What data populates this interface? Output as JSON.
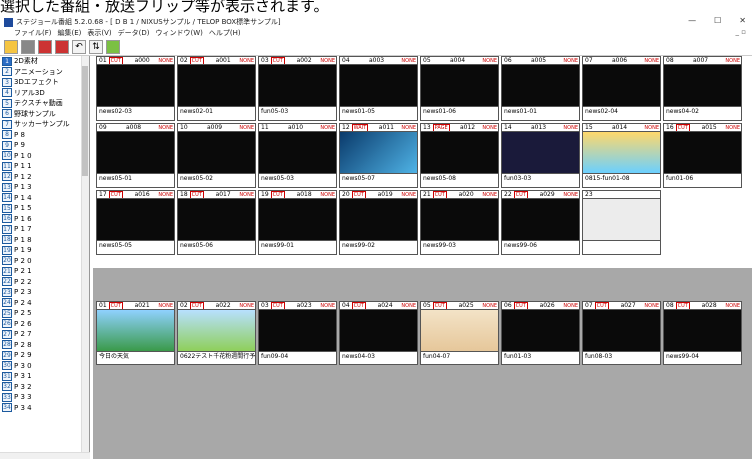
{
  "caption": "選択した番組・放送フリップ等が表示されます。",
  "window": {
    "title": "ステジョール番組 5.2.0.68 - [ D B 1 / NIXUSサンプル / TELOP BOX標準サンプル]",
    "minimize": "—",
    "maximize": "☐",
    "close": "✕",
    "menu_right": "_ ▫"
  },
  "menu": [
    "ファイル(F)",
    "編集(E)",
    "表示(V)",
    "データ(D)",
    "ウィンドウ(W)",
    "ヘルプ(H)"
  ],
  "sidebar": {
    "items": [
      {
        "num": "1",
        "label": "2D素材"
      },
      {
        "num": "2",
        "label": "アニメーション"
      },
      {
        "num": "3",
        "label": "3Dエフェクト"
      },
      {
        "num": "4",
        "label": "リアル3D"
      },
      {
        "num": "5",
        "label": "テクスチャ動画"
      },
      {
        "num": "6",
        "label": "野球サンプル"
      },
      {
        "num": "7",
        "label": "サッカーサンプル"
      },
      {
        "num": "8",
        "label": "P 8"
      },
      {
        "num": "9",
        "label": "P 9"
      },
      {
        "num": "10",
        "label": "P 1 0"
      },
      {
        "num": "11",
        "label": "P 1 1"
      },
      {
        "num": "12",
        "label": "P 1 2"
      },
      {
        "num": "13",
        "label": "P 1 3"
      },
      {
        "num": "14",
        "label": "P 1 4"
      },
      {
        "num": "15",
        "label": "P 1 5"
      },
      {
        "num": "16",
        "label": "P 1 6"
      },
      {
        "num": "17",
        "label": "P 1 7"
      },
      {
        "num": "18",
        "label": "P 1 8"
      },
      {
        "num": "19",
        "label": "P 1 9"
      },
      {
        "num": "20",
        "label": "P 2 0"
      },
      {
        "num": "21",
        "label": "P 2 1"
      },
      {
        "num": "22",
        "label": "P 2 2"
      },
      {
        "num": "23",
        "label": "P 2 3"
      },
      {
        "num": "24",
        "label": "P 2 4"
      },
      {
        "num": "25",
        "label": "P 2 5"
      },
      {
        "num": "26",
        "label": "P 2 6"
      },
      {
        "num": "27",
        "label": "P 2 7"
      },
      {
        "num": "28",
        "label": "P 2 8"
      },
      {
        "num": "29",
        "label": "P 2 9"
      },
      {
        "num": "30",
        "label": "P 3 0"
      },
      {
        "num": "31",
        "label": "P 3 1"
      },
      {
        "num": "32",
        "label": "P 3 2"
      },
      {
        "num": "33",
        "label": "P 3 3"
      },
      {
        "num": "34",
        "label": "P 3 4"
      }
    ]
  },
  "top_cells": [
    {
      "num": "01",
      "tag": "CUT",
      "code": "a000",
      "flag": "NONE",
      "foot": "news02-03"
    },
    {
      "num": "02",
      "tag": "CUT",
      "code": "a001",
      "flag": "NONE",
      "foot": "news02-01"
    },
    {
      "num": "03",
      "tag": "CUT",
      "code": "a002",
      "flag": "NONE",
      "foot": "fun05-03"
    },
    {
      "num": "04",
      "tag": "",
      "code": "a003",
      "flag": "NONE",
      "foot": "news01-05"
    },
    {
      "num": "05",
      "tag": "",
      "code": "a004",
      "flag": "NONE",
      "foot": "news01-06"
    },
    {
      "num": "06",
      "tag": "",
      "code": "a005",
      "flag": "NONE",
      "foot": "news01-01"
    },
    {
      "num": "07",
      "tag": "",
      "code": "a006",
      "flag": "NONE",
      "foot": "news02-04"
    },
    {
      "num": "08",
      "tag": "",
      "code": "a007",
      "flag": "NONE",
      "foot": "news04-02"
    },
    {
      "num": "09",
      "tag": "",
      "code": "a008",
      "flag": "NONE",
      "foot": "news05-01"
    },
    {
      "num": "10",
      "tag": "",
      "code": "a009",
      "flag": "NONE",
      "foot": "news05-02"
    },
    {
      "num": "11",
      "tag": "",
      "code": "a010",
      "flag": "NONE",
      "foot": "news05-03"
    },
    {
      "num": "12",
      "tag": "WAIT",
      "code": "a011",
      "flag": "NONE",
      "foot": "news05-07"
    },
    {
      "num": "13",
      "tag": "PAGE",
      "code": "a012",
      "flag": "NONE",
      "foot": "news05-08"
    },
    {
      "num": "14",
      "tag": "",
      "code": "a013",
      "flag": "NONE",
      "foot": "fun03-03"
    },
    {
      "num": "15",
      "tag": "",
      "code": "a014",
      "flag": "NONE",
      "foot": "0815-fun01-08"
    },
    {
      "num": "16",
      "tag": "CUT",
      "code": "a015",
      "flag": "NONE",
      "foot": "fun01-06"
    },
    {
      "num": "17",
      "tag": "CUT",
      "code": "a016",
      "flag": "NONE",
      "foot": "news05-05"
    },
    {
      "num": "18",
      "tag": "CUT",
      "code": "a017",
      "flag": "NONE",
      "foot": "news05-06"
    },
    {
      "num": "19",
      "tag": "CUT",
      "code": "a018",
      "flag": "NONE",
      "foot": "news99-01"
    },
    {
      "num": "20",
      "tag": "CUT",
      "code": "a019",
      "flag": "NONE",
      "foot": "news99-02"
    },
    {
      "num": "21",
      "tag": "CUT",
      "code": "a020",
      "flag": "NONE",
      "foot": "news99-03"
    },
    {
      "num": "22",
      "tag": "CUT",
      "code": "a029",
      "flag": "NONE",
      "foot": "news99-06"
    },
    {
      "num": "23",
      "tag": "",
      "code": "",
      "flag": "",
      "foot": ""
    }
  ],
  "bottom_cells": [
    {
      "num": "01",
      "tag": "CUT",
      "code": "a021",
      "flag": "NONE",
      "foot": "今日の天気"
    },
    {
      "num": "02",
      "tag": "CUT",
      "code": "a022",
      "flag": "NONE",
      "foot": "0622テスト千花粉週間行予報"
    },
    {
      "num": "03",
      "tag": "CUT",
      "code": "a023",
      "flag": "NONE",
      "foot": "fun09-04"
    },
    {
      "num": "04",
      "tag": "CUT",
      "code": "a024",
      "flag": "NONE",
      "foot": "news04-03"
    },
    {
      "num": "05",
      "tag": "CUT",
      "code": "a025",
      "flag": "NONE",
      "foot": "fun04-07"
    },
    {
      "num": "06",
      "tag": "CUT",
      "code": "a026",
      "flag": "NONE",
      "foot": "fun01-03"
    },
    {
      "num": "07",
      "tag": "CUT",
      "code": "a027",
      "flag": "NONE",
      "foot": "fun08-03"
    },
    {
      "num": "08",
      "tag": "CUT",
      "code": "a028",
      "flag": "NONE",
      "foot": "news99-04"
    }
  ]
}
